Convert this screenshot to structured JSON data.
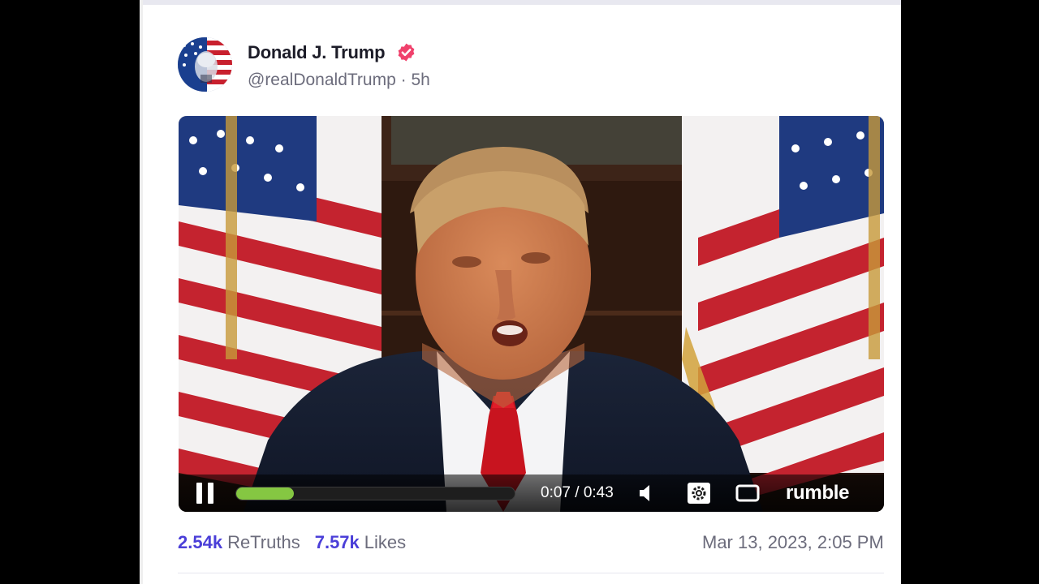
{
  "post": {
    "author_name": "Donald J. Trump",
    "handle": "@realDonaldTrump",
    "separator": "·",
    "age": "5h",
    "verified_icon": "verified-badge-icon",
    "avatar_icon": "flag-portrait-avatar",
    "accent_color": "#4b3fd8",
    "verified_color": "#f0416c"
  },
  "video": {
    "current_time": "0:07",
    "duration": "0:43",
    "time_sep": "/",
    "progress": 0.163,
    "progress_color": "#85c742",
    "brand": "rumble",
    "icons": [
      "pause-icon",
      "volume-icon",
      "settings-gear-icon",
      "fullscreen-icon"
    ]
  },
  "stats": {
    "retruths_count": "2.54k",
    "retruths_label": "ReTruths",
    "likes_count": "7.57k",
    "likes_label": "Likes",
    "timestamp": "Mar 13, 2023, 2:05 PM"
  }
}
